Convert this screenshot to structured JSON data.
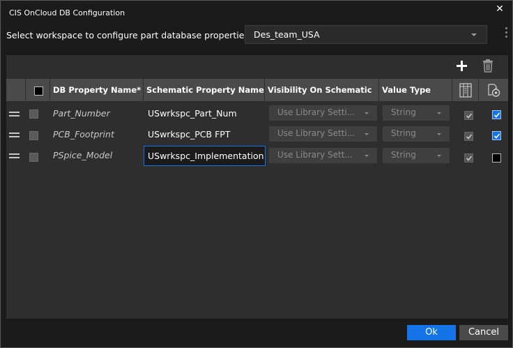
{
  "window": {
    "title": "CIS OnCloud DB Configuration",
    "close_glyph": "✕"
  },
  "workspace": {
    "label": "Select workspace to configure part database properties",
    "selected": "Des_team_USA"
  },
  "toolbar": {
    "add_icon": "plus-icon",
    "delete_icon": "trash-icon"
  },
  "table": {
    "headers": {
      "db_property_name": "DB Property Name*",
      "schematic_property_name": "Schematic Property Name",
      "visibility": "Visibility On Schematic",
      "value_type": "Value Type",
      "library_icon": "library-columns-icon",
      "schematic_icon": "schematic-sync-icon"
    },
    "rows": [
      {
        "db_name": "Part_Number",
        "schematic_name": "USwrkspc_Part_Num",
        "visibility": "Use Library Setti...",
        "value_type": "String",
        "library_checked": true,
        "schematic_checked": true
      },
      {
        "db_name": "PCB_Footprint",
        "schematic_name": "USwrkspc_PCB FPT",
        "visibility": "Use Library Setti...",
        "value_type": "String",
        "library_checked": true,
        "schematic_checked": true
      },
      {
        "db_name": "PSpice_Model",
        "schematic_name": "USwrkspc_Implementation",
        "visibility": "Use Library Sett...",
        "value_type": "String",
        "library_checked": true,
        "schematic_checked": false
      }
    ]
  },
  "buttons": {
    "ok": "Ok",
    "cancel": "Cancel"
  },
  "colors": {
    "accent": "#1473e6",
    "background": "#1b1b1b",
    "panel": "#2e2e2e",
    "header": "#4a4a4a"
  }
}
